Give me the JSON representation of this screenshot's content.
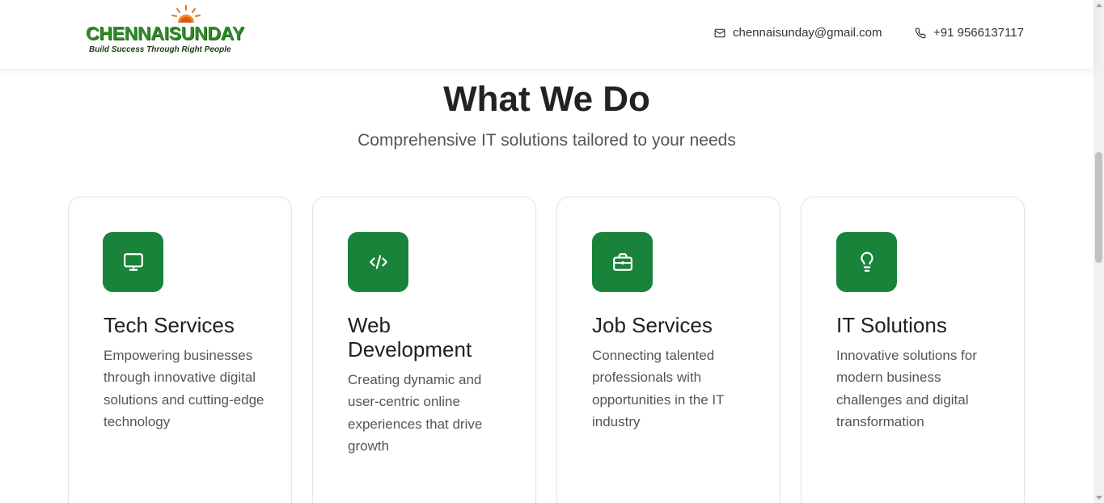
{
  "header": {
    "logo": {
      "name": "CHENNAISUNDAY",
      "tagline": "Build Success Through Right People"
    },
    "email": "chennaisunday@gmail.com",
    "phone": "+91 9566137117",
    "email_icon": "mail-icon",
    "phone_icon": "phone-icon"
  },
  "section": {
    "title": "What We Do",
    "subtitle": "Comprehensive IT solutions tailored to your needs"
  },
  "cards": [
    {
      "icon": "monitor-icon",
      "title": "Tech Services",
      "description": "Empowering businesses through innovative digital solutions and cutting-edge technology"
    },
    {
      "icon": "code-icon",
      "title": "Web Development",
      "description": "Creating dynamic and user-centric online experiences that drive growth"
    },
    {
      "icon": "briefcase-icon",
      "title": "Job Services",
      "description": "Connecting talented professionals with opportunities in the IT industry"
    },
    {
      "icon": "lightbulb-icon",
      "title": "IT Solutions",
      "description": "Innovative solutions for modern business challenges and digital transformation"
    }
  ],
  "colors": {
    "accent": "#188339",
    "logo_green": "#2f8a27",
    "sun_orange": "#e8731c"
  }
}
